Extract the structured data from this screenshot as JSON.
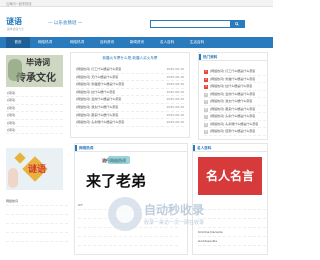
{
  "topbar": {
    "text": "云海问一起来猜谜"
  },
  "header": {
    "logo_main": "谜语",
    "logo_sub": "趣味谜语大全",
    "slogan": "— 以乐会猜谜 —",
    "search_placeholder": ""
  },
  "nav": {
    "items": [
      {
        "label": "首页"
      },
      {
        "label": "网络热词"
      },
      {
        "label": "网络热词"
      },
      {
        "label": "百科资讯"
      },
      {
        "label": "新闻资讯"
      },
      {
        "label": "名人百科"
      },
      {
        "label": "生活百科"
      }
    ]
  },
  "left_hero": {
    "line1": "毕诗词",
    "line2": "传承文化"
  },
  "left_list": [
    "[诗词]",
    "[诗词]",
    "[诗词]",
    "[诗词]",
    "[诗词]",
    "[诗词]"
  ],
  "middle": {
    "headline": "新疆火车票什么是,新疆人买火车票",
    "news": [
      {
        "title": "[网络热词] 打工什么梗是什么意思",
        "date": "2025-08-16"
      },
      {
        "title": "[网络热词] 天什么梗是什么意思",
        "date": "2025-08-16"
      },
      {
        "title": "[网络热词] 鲁猫团什么梗是什么意思",
        "date": "2025-08-16"
      },
      {
        "title": "[网络热词] 扯什么梗什么意思",
        "date": "2025-08-16"
      },
      {
        "title": "[网络热词] 爱的什么梗是什么意思",
        "date": "2025-08-16"
      },
      {
        "title": "[网络热词] 我太什么梗什么意思",
        "date": "2025-08-16"
      },
      {
        "title": "[网络热词] 跟来什么梗什么意思",
        "date": "2025-08-16"
      },
      {
        "title": "[网络热词] 头条爆什么梗是什么意思",
        "date": "2025-08-16"
      }
    ]
  },
  "right": {
    "title": "热门资料",
    "ranks": [
      {
        "num": "1",
        "text": "[网络热词] 打工什么梗是什么意思",
        "hot": true
      },
      {
        "num": "2",
        "text": "[网络热词] 鲁猫什么梗是什么意思",
        "hot": true
      },
      {
        "num": "3",
        "text": "[网络热词] 扯什么梗是什么意思",
        "hot": true
      },
      {
        "num": "4",
        "text": "[网络热词] 爱的什么梗是什么意思",
        "hot": false
      },
      {
        "num": "5",
        "text": "[网络热词] 我太什么梗什么意思",
        "hot": false
      },
      {
        "num": "6",
        "text": "[网络热词] 跟来什么梗是什么意思",
        "hot": false
      },
      {
        "num": "7",
        "text": "[网络热词] 头条什么梗是什么意思",
        "hot": false
      },
      {
        "num": "8",
        "text": "[网络热词] 头条爆什么梗是什么意思",
        "hot": false
      },
      {
        "num": "9",
        "text": "[网络热词] 回家什么梗是什么意思",
        "hot": false
      },
      {
        "num": "10",
        "text": "[网络热词] 出什么梗什么意思",
        "hot": false
      },
      {
        "num": "11",
        "text": "[网络热词] 又什么梗是什么意思",
        "hot": false
      }
    ]
  },
  "section2": {
    "left_title": "网络热词",
    "mid_title": "网络热词",
    "right_title": "名人百科"
  },
  "left_hero2": {
    "text": "谜语"
  },
  "img_mid": {
    "line1": "流行网络热词",
    "big": "来了老弟"
  },
  "img_right": {
    "text": "名人名言"
  },
  "watermark": {
    "title": "自动秒收录",
    "sub": "收录一来访一次一即在收录"
  },
  "bottom_left": [
    "网络热词",
    "",
    "",
    "",
    ""
  ],
  "bottom_mid": [
    "ICT",
    "",
    "",
    "",
    ""
  ],
  "bottom_right": [
    "",
    "",
    "",
    "Kristina Danielle",
    "Goddessville"
  ],
  "colors": {
    "brand": "#2a7bbd",
    "hot": "#e9463c"
  }
}
